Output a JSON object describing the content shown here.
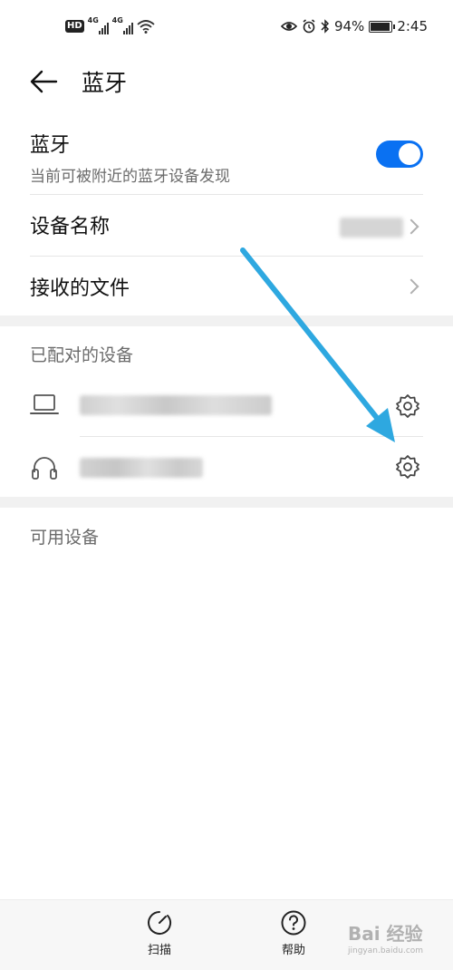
{
  "status_bar": {
    "hd": "HD",
    "net1": "4G",
    "net2": "4G",
    "battery": "94%",
    "time": "2:45"
  },
  "header": {
    "title": "蓝牙"
  },
  "bluetooth_row": {
    "title": "蓝牙",
    "subtitle": "当前可被附近的蓝牙设备发现",
    "enabled": true
  },
  "device_name_row": {
    "title": "设备名称"
  },
  "received_files_row": {
    "title": "接收的文件"
  },
  "paired_section": {
    "title": "已配对的设备",
    "devices": [
      {
        "icon": "laptop-icon"
      },
      {
        "icon": "headset-icon"
      }
    ]
  },
  "available_section": {
    "title": "可用设备"
  },
  "bottom_bar": {
    "scan_label": "扫描",
    "help_label": "帮助"
  },
  "watermark": {
    "main": "Bai 经验",
    "sub": "jingyan.baidu.com"
  },
  "colors": {
    "accent": "#0a71f2",
    "annotation_arrow": "#2ea8e0"
  }
}
